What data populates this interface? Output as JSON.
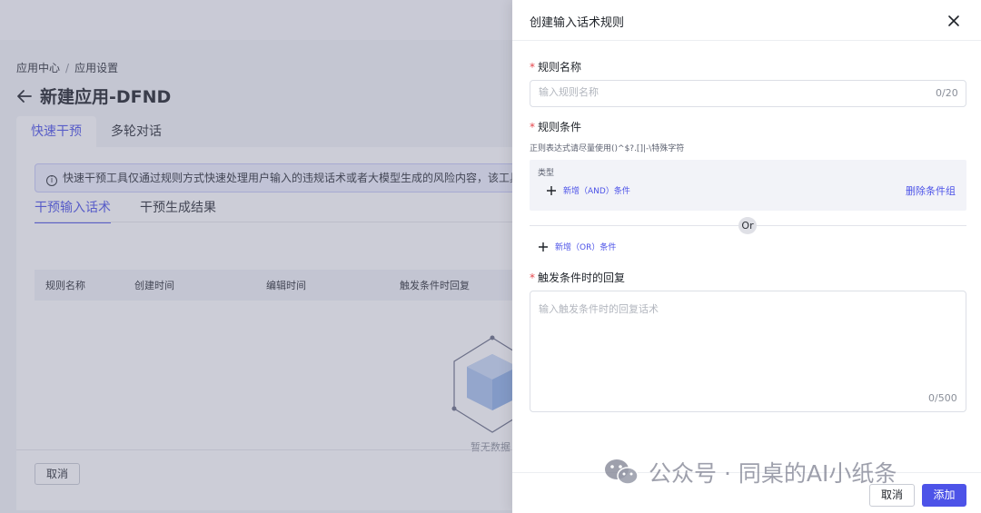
{
  "background": {
    "breadcrumb": {
      "root": "应用中心",
      "separator": "/",
      "current": "应用设置"
    },
    "page_title": "新建应用-DFND",
    "tabs": [
      {
        "label": "快速干预",
        "active": true
      },
      {
        "label": "多轮对话",
        "active": false
      }
    ],
    "notice_text": "快速干预工具仅通过规则方式快速处理用户输入的违规话术或者大模型生成的风险内容，该工具无法",
    "sub_tabs": [
      {
        "label": "干预输入话术",
        "active": true
      },
      {
        "label": "干预生成结果",
        "active": false
      }
    ],
    "table_columns": [
      "规则名称",
      "创建时间",
      "编辑时间",
      "触发条件时回复"
    ],
    "empty_text": "暂无数据",
    "cancel_label": "取消"
  },
  "drawer": {
    "title": "创建输入话术规则",
    "rule_name": {
      "label": "规则名称",
      "required_mark": "*",
      "placeholder": "输入规则名称",
      "value": "",
      "counter": "0/20"
    },
    "rule_conditions": {
      "label": "规则条件",
      "required_mark": "*",
      "hint": "正则表达式请尽量使用()^$?.[]|-\\特殊字符",
      "group": {
        "type_label": "类型",
        "add_and_label": "新增（AND）条件",
        "delete_group_label": "删除条件组"
      },
      "or_label": "Or",
      "add_or_label": "新增（OR）条件"
    },
    "reply": {
      "label": "触发条件时的回复",
      "required_mark": "*",
      "placeholder": "输入触发条件时的回复话术",
      "value": "",
      "counter": "0/500"
    },
    "footer": {
      "cancel_label": "取消",
      "add_label": "添加"
    }
  },
  "watermark": {
    "text": "公众号 · 同桌的AI小纸条"
  },
  "colors": {
    "accent": "#4d53e8",
    "required": "#e5484d",
    "mask": "rgba(110,112,140,0.35)"
  }
}
